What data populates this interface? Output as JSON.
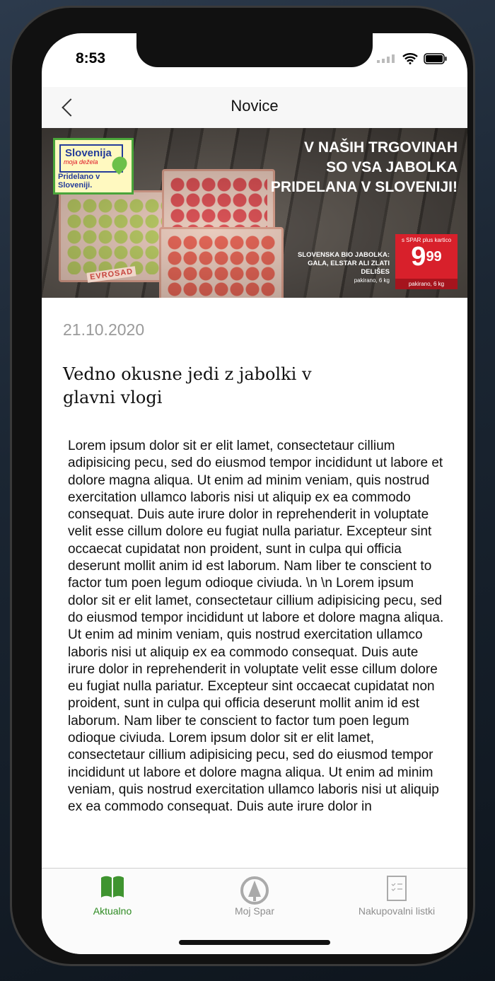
{
  "status": {
    "time": "8:53"
  },
  "nav": {
    "title": "Novice"
  },
  "banner": {
    "logo_line1": "Slovenija",
    "logo_line2": "moja dežela",
    "logo_line3": "Pridelano v Sloveniji.",
    "headline": [
      "V NAŠIH TRGOVINAH",
      "SO VSA JABOLKA",
      "PRIDELANA V SLOVENIJI!"
    ],
    "crate_label": "EVROSAD",
    "product": [
      "SLOVENSKA BIO JABOLKA:",
      "GALA, ELSTAR ALI ZLATI",
      "DELIŠES"
    ],
    "product_pack": "pakirano, 6 kg",
    "price_caption": "s SPAR plus kartico",
    "price_main": "9",
    "price_cents": "99",
    "price_pack": "pakirano, 6 kg"
  },
  "article": {
    "date": "21.10.2020",
    "title": "Vedno okusne jedi z jabolki v glavni vlogi",
    "body": "Lorem ipsum dolor sit er elit lamet, consectetaur cillium adipisicing pecu, sed do eiusmod tempor incididunt ut labore et dolore magna aliqua. Ut enim ad minim veniam, quis nostrud exercitation ullamco laboris nisi ut aliquip ex ea commodo consequat. Duis aute irure dolor in reprehenderit in voluptate velit esse cillum dolore eu fugiat nulla pariatur. Excepteur sint occaecat cupidatat non proident, sunt in culpa qui officia deserunt mollit anim id est laborum. Nam liber te conscient to factor tum poen legum odioque civiuda. \\n \\n Lorem ipsum dolor sit er elit lamet, consectetaur cillium adipisicing pecu, sed do eiusmod tempor incididunt ut labore et dolore magna aliqua. Ut enim ad minim veniam, quis nostrud exercitation ullamco laboris nisi ut aliquip ex ea commodo consequat. Duis aute irure dolor in reprehenderit in voluptate velit esse cillum dolore eu fugiat nulla pariatur. Excepteur sint occaecat cupidatat non proident, sunt in culpa qui officia deserunt mollit anim id est laborum. Nam liber te conscient to factor tum poen legum odioque civiuda. Lorem ipsum dolor sit er elit lamet, consectetaur cillium adipisicing pecu, sed do eiusmod tempor incididunt ut labore et dolore magna aliqua. Ut enim ad minim veniam, quis nostrud exercitation ullamco laboris nisi ut aliquip ex ea commodo consequat. Duis aute irure dolor in"
  },
  "tabs": [
    {
      "label": "Aktualno",
      "icon": "book-icon",
      "active": true
    },
    {
      "label": "Moj Spar",
      "icon": "spar-tree-icon",
      "active": false
    },
    {
      "label": "Nakupovalni listki",
      "icon": "checklist-icon",
      "active": false
    }
  ],
  "colors": {
    "accent": "#2e8b22",
    "inactive": "#8e8e8e",
    "price": "#d8202b"
  }
}
